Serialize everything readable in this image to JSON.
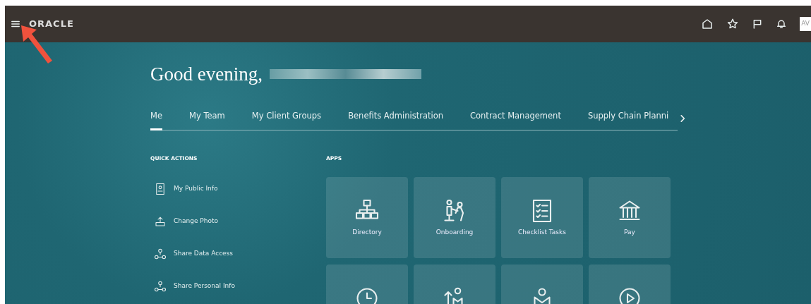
{
  "header": {
    "logo": "ORACLE",
    "avatar": "AV"
  },
  "greeting": "Good evening,",
  "tabs": [
    {
      "label": "Me",
      "selected": true
    },
    {
      "label": "My Team",
      "selected": false
    },
    {
      "label": "My Client Groups",
      "selected": false
    },
    {
      "label": "Benefits Administration",
      "selected": false
    },
    {
      "label": "Contract Management",
      "selected": false
    },
    {
      "label": "Supply Chain Planni",
      "selected": false
    }
  ],
  "quick_actions": {
    "title": "QUICK ACTIONS",
    "items": [
      "My Public Info",
      "Change Photo",
      "Share Data Access",
      "Share Personal Info"
    ]
  },
  "apps": {
    "title": "APPS",
    "tiles": [
      {
        "kind": "labeled",
        "label": "Directory"
      },
      {
        "kind": "labeled",
        "label": "Onboarding"
      },
      {
        "kind": "labeled",
        "label": "Checklist Tasks"
      },
      {
        "kind": "labeled",
        "label": "Pay"
      },
      {
        "kind": "cut_off"
      },
      {
        "kind": "cut_off"
      },
      {
        "kind": "cut_off"
      },
      {
        "kind": "cut_off"
      }
    ]
  }
}
